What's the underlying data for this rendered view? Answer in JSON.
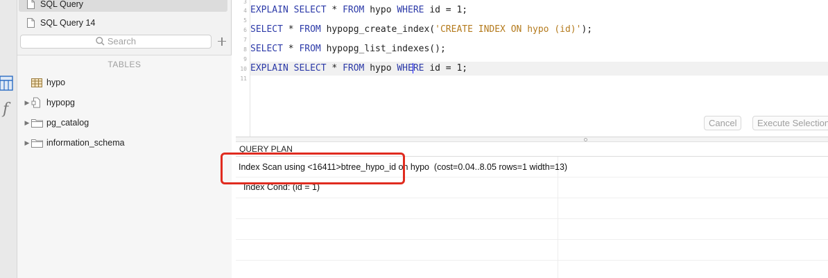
{
  "sidebar": {
    "queries": [
      {
        "label": "SQL Query",
        "selected": true
      },
      {
        "label": "SQL Query 14",
        "selected": false
      }
    ],
    "search": {
      "placeholder": "Search"
    },
    "tables_header": "TABLES",
    "tree": [
      {
        "label": "hypo",
        "icon": "table-icon",
        "expandable": false
      },
      {
        "label": "hypopg",
        "icon": "extension-icon",
        "expandable": true
      },
      {
        "label": "pg_catalog",
        "icon": "folder-icon",
        "expandable": true
      },
      {
        "label": "information_schema",
        "icon": "folder-icon",
        "expandable": true
      }
    ]
  },
  "editor": {
    "line_numbers": [
      "3",
      "4",
      "5",
      "6",
      "7",
      "8",
      "9",
      "10",
      "11"
    ],
    "lines": [
      "EXPLAIN SELECT * FROM hypo WHERE id = 1;",
      "SELECT * FROM hypopg_create_index('CREATE INDEX ON hypo (id)');",
      "SELECT * FROM hypopg_list_indexes();",
      "EXPLAIN SELECT * FROM hypo WHERE id = 1;"
    ],
    "cancel_label": "Cancel",
    "execute_label": "Execute Selection"
  },
  "results": {
    "column_header": "QUERY PLAN",
    "rows": [
      "Index Scan using <16411>btree_hypo_id on hypo  (cost=0.04..8.05 rows=1 width=13)",
      "  Index Cond: (id = 1)"
    ]
  },
  "colors": {
    "keyword": "#2c3aa8",
    "string": "#b47a1c",
    "highlight_box": "#e02b1f"
  }
}
